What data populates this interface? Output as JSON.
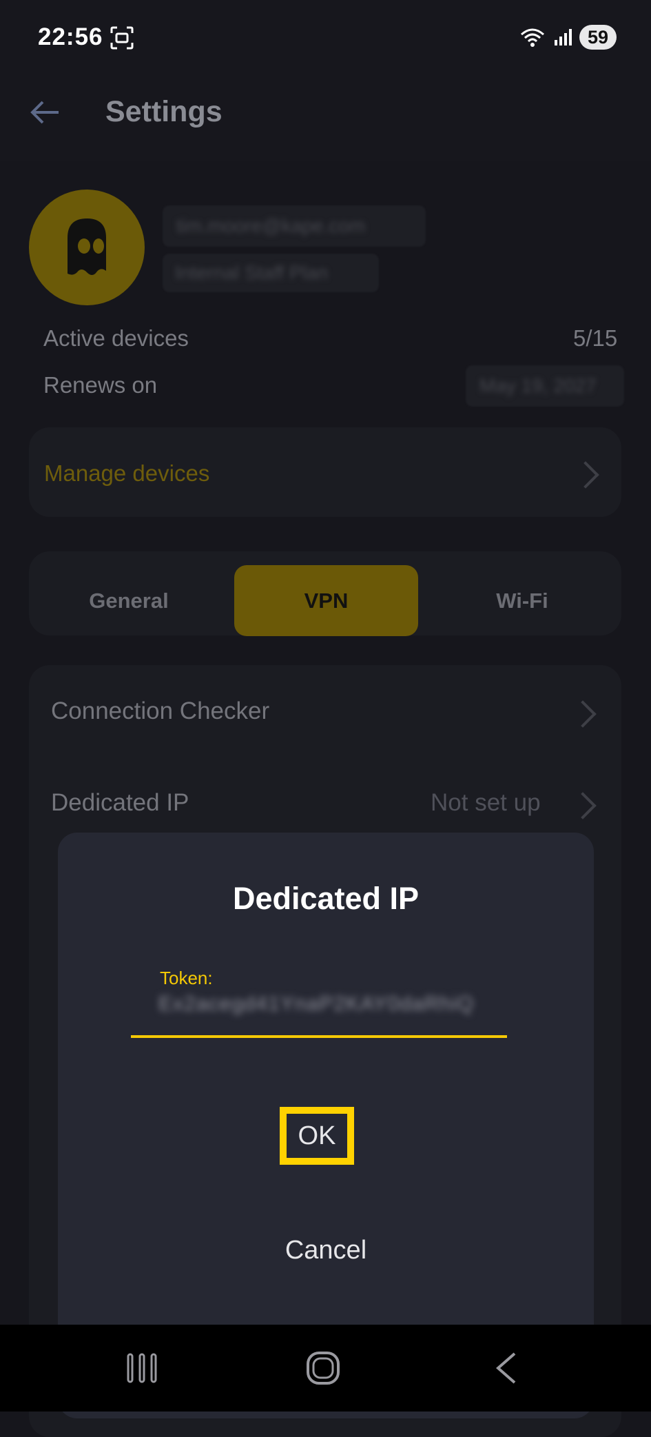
{
  "status_bar": {
    "time": "22:56",
    "battery": "59"
  },
  "header": {
    "title": "Settings"
  },
  "account": {
    "email": "tim.moore@kape.com",
    "plan": "Internal Staff Plan",
    "active_devices_label": "Active devices",
    "active_devices_value": "5/15",
    "renews_label": "Renews on",
    "renews_value": "May 19, 2027"
  },
  "manage_devices": {
    "label": "Manage devices"
  },
  "tabs": [
    {
      "label": "General",
      "active": false
    },
    {
      "label": "VPN",
      "active": true
    },
    {
      "label": "Wi-Fi",
      "active": false
    }
  ],
  "settings": {
    "connection_checker": "Connection Checker",
    "dedicated_ip": "Dedicated IP",
    "dedicated_ip_value": "Not set up"
  },
  "dialog": {
    "title": "Dedicated IP",
    "token_label": "Token:",
    "token_value": "Ex2acegd41YnaP2KAY0daRhiQ",
    "ok_label": "OK",
    "cancel_label": "Cancel"
  },
  "colors": {
    "accent": "#f5c905",
    "highlight": "#ffd200",
    "dialog_bg": "#262833",
    "background": "#16161c"
  }
}
